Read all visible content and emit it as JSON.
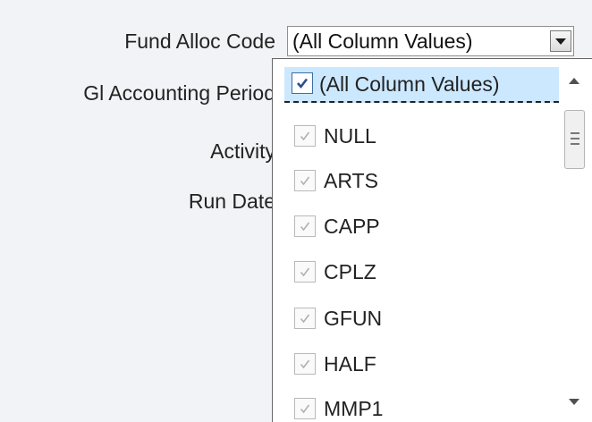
{
  "form": {
    "fund_alloc_label": "Fund Alloc Code",
    "gl_period_label": "Gl Accounting Period",
    "activity_label": "Activity",
    "run_date_label": "Run Date",
    "fund_alloc_value": "(All Column Values)"
  },
  "dropdown": {
    "items": [
      {
        "label": "(All Column Values)",
        "checked": true
      },
      {
        "label": "NULL",
        "checked": true
      },
      {
        "label": "ARTS",
        "checked": true
      },
      {
        "label": "CAPP",
        "checked": true
      },
      {
        "label": "CPLZ",
        "checked": true
      },
      {
        "label": "GFUN",
        "checked": true
      },
      {
        "label": "HALF",
        "checked": true
      },
      {
        "label": "MMP1",
        "checked": true
      }
    ]
  },
  "icons": {
    "combo_arrow": "chevron-down-icon",
    "checkbox": "checkmark-icon",
    "scroll_up": "scroll-up-arrow-icon",
    "scroll_down": "scroll-down-arrow-icon",
    "scroll_grip": "scrollbar-grip-icon"
  },
  "colors": {
    "selected_item_bg": "#cce8ff",
    "active_checkbox_border": "#3b6ea5",
    "disabled_checkbox_border": "#b9b9b9"
  }
}
